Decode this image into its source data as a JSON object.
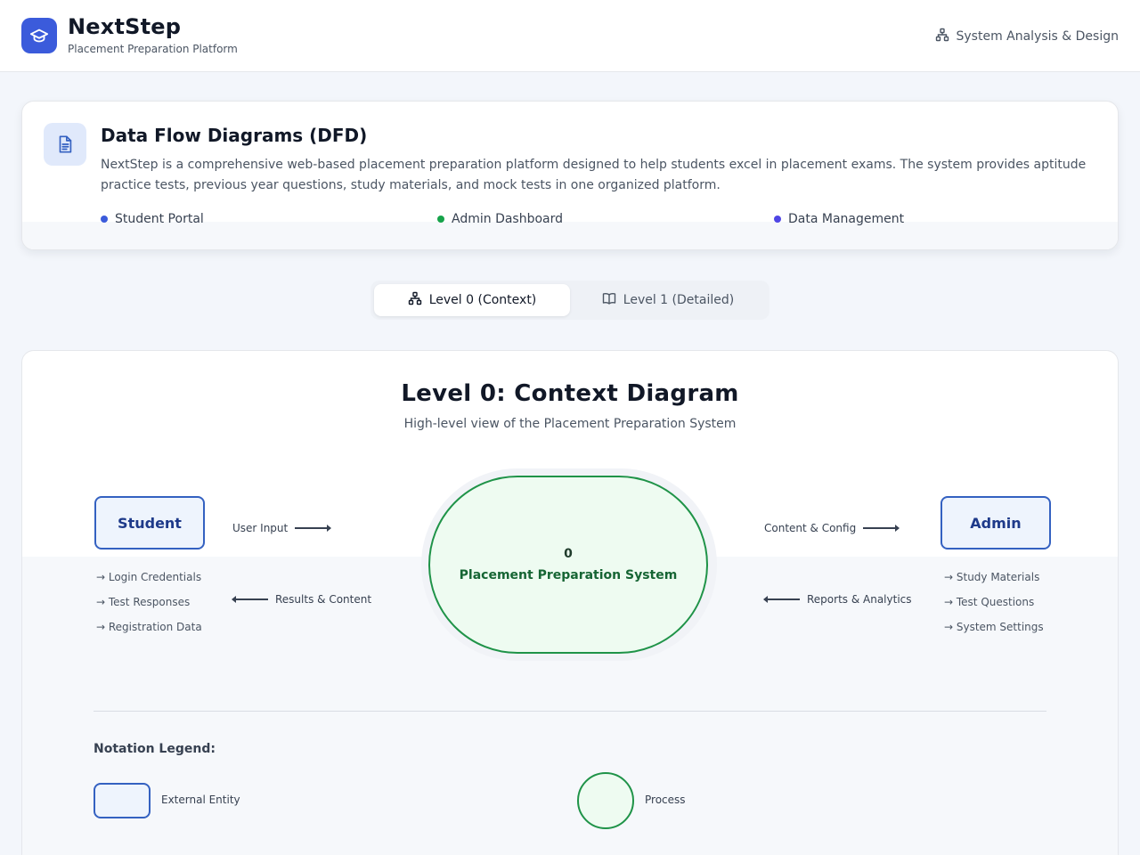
{
  "header": {
    "title": "NextStep",
    "subtitle": "Placement Preparation Platform",
    "right_label": "System Analysis & Design"
  },
  "intro": {
    "title": "Data Flow Diagrams (DFD)",
    "description": "NextStep is a comprehensive web-based placement preparation platform designed to help students excel in placement exams. The system provides aptitude practice tests, previous year questions, study materials, and mock tests in one organized platform.",
    "features": [
      {
        "label": "Student Portal",
        "color": "#3b5bdb"
      },
      {
        "label": "Admin Dashboard",
        "color": "#16a34a"
      },
      {
        "label": "Data Management",
        "color": "#4f46e5"
      }
    ]
  },
  "tabs": [
    {
      "label": "Level 0 (Context)",
      "active": true
    },
    {
      "label": "Level 1 (Detailed)",
      "active": false
    }
  ],
  "diagram": {
    "title": "Level 0: Context Diagram",
    "subtitle": "High-level view of the Placement Preparation System",
    "student": {
      "label": "Student",
      "flow_out": "User Input",
      "flow_in": "Results & Content",
      "data": [
        "→ Login Credentials",
        "→ Test Responses",
        "→ Registration Data"
      ]
    },
    "admin": {
      "label": "Admin",
      "flow_out": "Content & Config",
      "flow_in": "Reports & Analytics",
      "data": [
        "→ Study Materials",
        "→ Test Questions",
        "→ System Settings"
      ]
    },
    "process": {
      "number": "0",
      "label": "Placement Preparation System"
    }
  },
  "legend": {
    "title": "Notation Legend:",
    "entity_label": "External Entity",
    "process_label": "Process"
  }
}
